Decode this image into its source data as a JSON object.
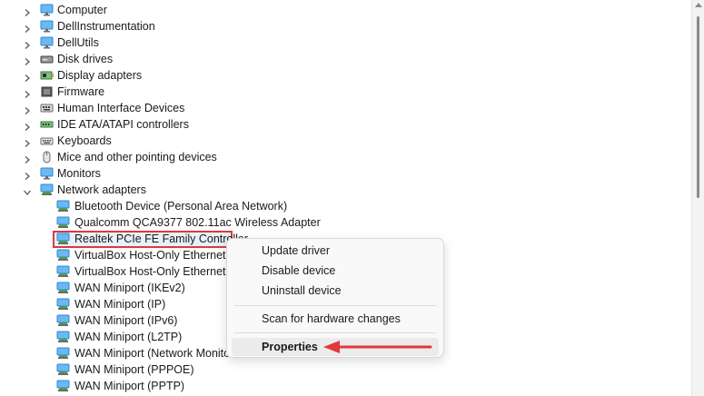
{
  "tree": {
    "categories": [
      {
        "label": "Computer",
        "icon": "computer-icon"
      },
      {
        "label": "DellInstrumentation",
        "icon": "monitor-icon"
      },
      {
        "label": "DellUtils",
        "icon": "monitor-icon"
      },
      {
        "label": "Disk drives",
        "icon": "disk-drive-icon"
      },
      {
        "label": "Display adapters",
        "icon": "display-adapter-icon"
      },
      {
        "label": "Firmware",
        "icon": "firmware-icon"
      },
      {
        "label": "Human Interface Devices",
        "icon": "hid-icon"
      },
      {
        "label": "IDE ATA/ATAPI controllers",
        "icon": "ide-controller-icon"
      },
      {
        "label": "Keyboards",
        "icon": "keyboard-icon"
      },
      {
        "label": "Mice and other pointing devices",
        "icon": "mouse-icon"
      },
      {
        "label": "Monitors",
        "icon": "monitor-icon"
      },
      {
        "label": "Network adapters",
        "icon": "network-adapter-icon",
        "expanded": true
      }
    ],
    "network_adapters": [
      {
        "label": "Bluetooth Device (Personal Area Network)"
      },
      {
        "label": "Qualcomm QCA9377 802.11ac Wireless Adapter"
      },
      {
        "label": "Realtek PCIe FE Family Controller",
        "selected": true
      },
      {
        "label": "VirtualBox Host-Only Ethernet A"
      },
      {
        "label": "VirtualBox Host-Only Ethernet A"
      },
      {
        "label": "WAN Miniport (IKEv2)"
      },
      {
        "label": "WAN Miniport (IP)"
      },
      {
        "label": "WAN Miniport (IPv6)"
      },
      {
        "label": "WAN Miniport (L2TP)"
      },
      {
        "label": "WAN Miniport (Network Monito"
      },
      {
        "label": "WAN Miniport (PPPOE)"
      },
      {
        "label": "WAN Miniport (PPTP)"
      }
    ]
  },
  "context_menu": {
    "items": [
      {
        "label": "Update driver"
      },
      {
        "label": "Disable device"
      },
      {
        "label": "Uninstall device"
      },
      {
        "label": "Scan for hardware changes"
      },
      {
        "label": "Properties",
        "highlighted": true
      }
    ]
  },
  "colors": {
    "highlight_border": "#e0383b",
    "annotation_arrow": "#e0383b",
    "selection_fill": "#e8f1fb"
  }
}
